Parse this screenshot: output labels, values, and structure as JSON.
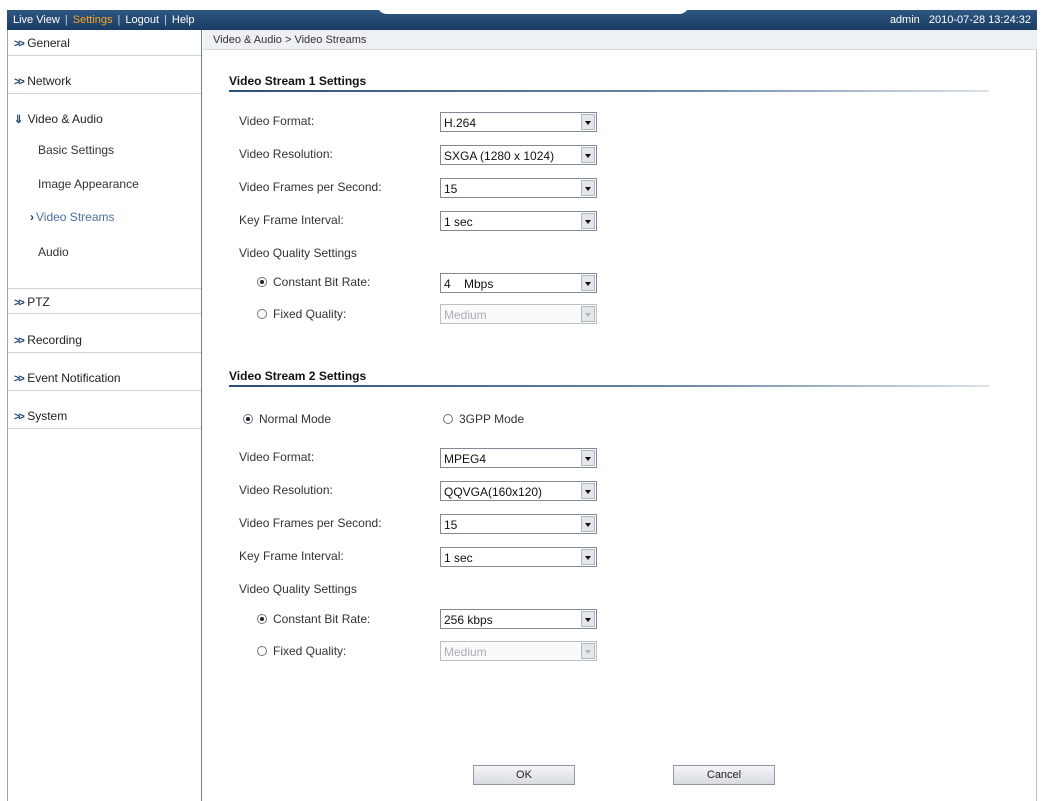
{
  "topbar": {
    "nav": [
      "Live View",
      "Settings",
      "Logout",
      "Help"
    ],
    "active_nav": "Settings",
    "user": "admin",
    "datetime": "2010-07-28  13:24:32"
  },
  "sidebar": {
    "general": "General",
    "network": "Network",
    "video_audio": "Video & Audio",
    "sub": {
      "basic": "Basic Settings",
      "image": "Image Appearance",
      "streams": "Video Streams",
      "audio": "Audio"
    },
    "ptz": "PTZ",
    "recording": "Recording",
    "event": "Event Notification",
    "system": "System"
  },
  "breadcrumb": "Video & Audio > Video Streams",
  "stream1": {
    "title": "Video Stream 1 Settings",
    "format_label": "Video Format:",
    "format_value": "H.264",
    "resolution_label": "Video Resolution:",
    "resolution_value": "SXGA (1280 x 1024)",
    "fps_label": "Video Frames per Second:",
    "fps_value": "15",
    "keyframe_label": "Key Frame Interval:",
    "keyframe_value": "1 sec",
    "quality_label": "Video Quality Settings",
    "cbr_label": "Constant Bit Rate:",
    "cbr_value": "4    Mbps",
    "fixed_label": "Fixed Quality:",
    "fixed_value": "Medium"
  },
  "stream2": {
    "title": "Video Stream 2 Settings",
    "normal_mode": "Normal Mode",
    "gpp_mode": "3GPP Mode",
    "format_label": "Video Format:",
    "format_value": "MPEG4",
    "resolution_label": "Video Resolution:",
    "resolution_value": "QQVGA(160x120)",
    "fps_label": "Video Frames per Second:",
    "fps_value": "15",
    "keyframe_label": "Key Frame Interval:",
    "keyframe_value": "1 sec",
    "quality_label": "Video Quality Settings",
    "cbr_label": "Constant Bit Rate:",
    "cbr_value": "256 kbps",
    "fixed_label": "Fixed Quality:",
    "fixed_value": "Medium"
  },
  "buttons": {
    "ok": "OK",
    "cancel": "Cancel"
  },
  "colors": {
    "topbar": "#1f4470",
    "active_nav": "#f7a623",
    "section_line": "#2c4f7a"
  }
}
